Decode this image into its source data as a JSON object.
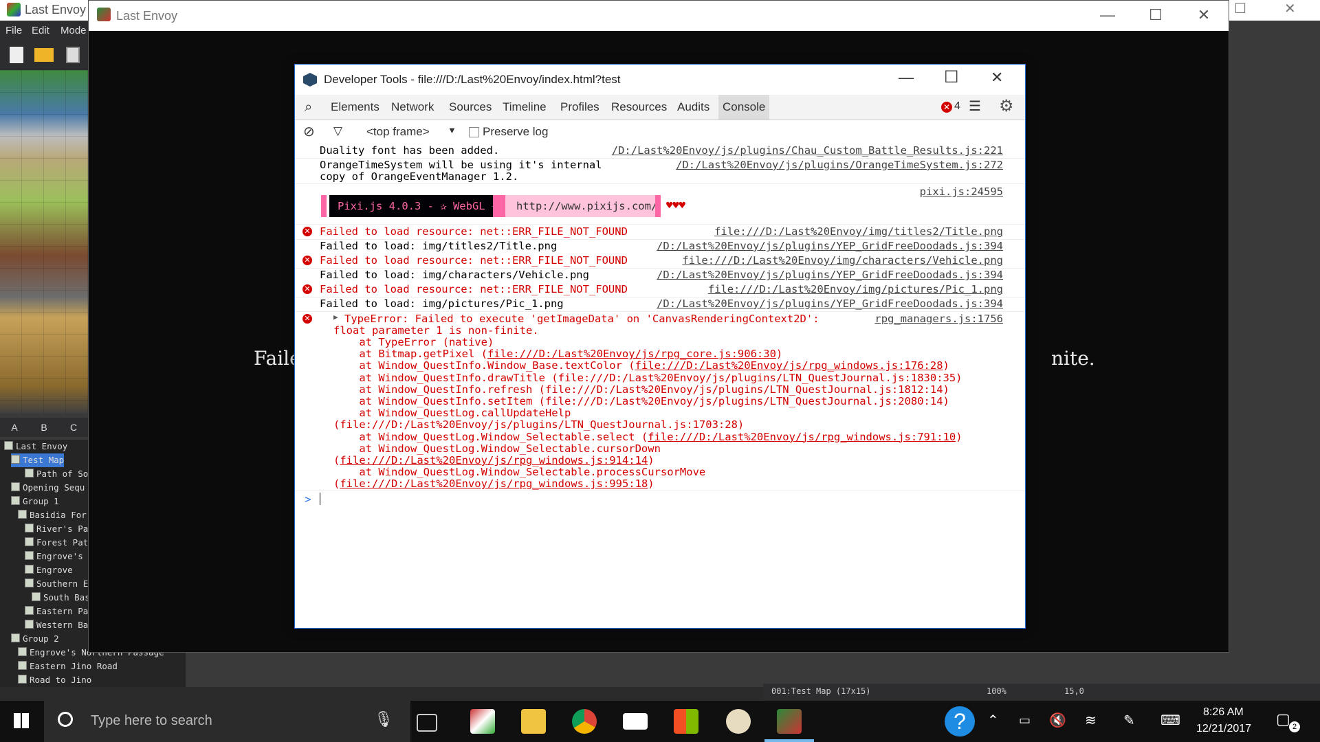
{
  "editor": {
    "title": "Last Envoy",
    "menu": [
      "File",
      "Edit",
      "Mode"
    ],
    "tabs": [
      "A",
      "B",
      "C"
    ],
    "tree": [
      {
        "label": "Last Envoy",
        "indent": 0
      },
      {
        "label": "Test Map",
        "indent": 1,
        "selected": true
      },
      {
        "label": "Path of Sou",
        "indent": 3
      },
      {
        "label": "Opening Sequ",
        "indent": 1
      },
      {
        "label": "Group 1",
        "indent": 1
      },
      {
        "label": "Basidia For",
        "indent": 2
      },
      {
        "label": "River's Pa",
        "indent": 3
      },
      {
        "label": "Forest Pat",
        "indent": 3
      },
      {
        "label": "Engrove's",
        "indent": 3
      },
      {
        "label": "Engrove",
        "indent": 3
      },
      {
        "label": "Southern E",
        "indent": 3
      },
      {
        "label": "South Bas",
        "indent": 4
      },
      {
        "label": "Eastern Pa",
        "indent": 3
      },
      {
        "label": "Western Ba",
        "indent": 3
      },
      {
        "label": "Group 2",
        "indent": 1
      },
      {
        "label": "Engrove's Northern Passage",
        "indent": 2
      },
      {
        "label": "Eastern Jino Road",
        "indent": 2
      },
      {
        "label": "Road to Jino",
        "indent": 2
      }
    ],
    "status_map": "001:Test Map (17x15)",
    "status_zoom": "100%",
    "status_coord": "15,0"
  },
  "game": {
    "title": "Last Envoy",
    "error_left": "Faile",
    "error_right": "nite."
  },
  "devtools": {
    "title": "Developer Tools - file:///D:/Last%20Envoy/index.html?test",
    "tabs": [
      "Elements",
      "Network",
      "Sources",
      "Timeline",
      "Profiles",
      "Resources",
      "Audits",
      "Console"
    ],
    "error_count": "4",
    "frame": "<top frame>",
    "preserve_log": "Preserve log",
    "pixi_banner": "Pixi.js 4.0.3 - ✰ WebGL ✰",
    "pixi_url": "http://www.pixijs.com/",
    "pixi_hearts": "♥♥♥",
    "pixi_src": "pixi.js:24595",
    "lines": [
      {
        "msg": "Duality font has been added.",
        "src": "/D:/Last%20Envoy/js/plugins/Chau_Custom_Battle_Results.js:221",
        "err": false
      },
      {
        "msg": "OrangeTimeSystem will be using it's internal",
        "msg2": "copy of OrangeEventManager 1.2.",
        "src": "/D:/Last%20Envoy/js/plugins/OrangeTimeSystem.js:272",
        "err": false
      },
      {
        "msg": "Failed to load resource: net::ERR_FILE_NOT_FOUND",
        "src": "file:///D:/Last%20Envoy/img/titles2/Title.png",
        "err": true
      },
      {
        "msg": "Failed to load: img/titles2/Title.png",
        "src": "/D:/Last%20Envoy/js/plugins/YEP_GridFreeDoodads.js:394",
        "err": false
      },
      {
        "msg": "Failed to load resource: net::ERR_FILE_NOT_FOUND",
        "src": "file:///D:/Last%20Envoy/img/characters/Vehicle.png",
        "err": true
      },
      {
        "msg": "Failed to load: img/characters/Vehicle.png",
        "src": "/D:/Last%20Envoy/js/plugins/YEP_GridFreeDoodads.js:394",
        "err": false
      },
      {
        "msg": "Failed to load resource: net::ERR_FILE_NOT_FOUND",
        "src": "file:///D:/Last%20Envoy/img/pictures/Pic_1.png",
        "err": true
      },
      {
        "msg": "Failed to load: img/pictures/Pic_1.png",
        "src": "/D:/Last%20Envoy/js/plugins/YEP_GridFreeDoodads.js:394",
        "err": false
      }
    ],
    "type_error": {
      "head": "TypeError: Failed to execute 'getImageData' on 'CanvasRenderingContext2D':",
      "head2": "float parameter 1 is non-finite.",
      "src": "rpg_managers.js:1756",
      "stack": [
        {
          "pre": "    at TypeError (native)",
          "link": "",
          "post": ""
        },
        {
          "pre": "    at Bitmap.getPixel (",
          "link": "file:///D:/Last%20Envoy/js/rpg_core.js:906:30",
          "post": ")"
        },
        {
          "pre": "    at Window_QuestInfo.Window_Base.textColor (",
          "link": "file:///D:/Last%20Envoy/js/rpg_windows.js:176:28",
          "post": ")"
        },
        {
          "pre": "    at Window_QuestInfo.drawTitle (file:///D:/Last%20Envoy/js/plugins/LTN_QuestJournal.js:1830:35)",
          "link": "",
          "post": ""
        },
        {
          "pre": "    at Window_QuestInfo.refresh (file:///D:/Last%20Envoy/js/plugins/LTN_QuestJournal.js:1812:14)",
          "link": "",
          "post": ""
        },
        {
          "pre": "    at Window_QuestInfo.setItem (file:///D:/Last%20Envoy/js/plugins/LTN_QuestJournal.js:2080:14)",
          "link": "",
          "post": ""
        },
        {
          "pre": "    at Window_QuestLog.callUpdateHelp",
          "link": "",
          "post": ""
        },
        {
          "pre": "(file:///D:/Last%20Envoy/js/plugins/LTN_QuestJournal.js:1703:28)",
          "link": "",
          "post": ""
        },
        {
          "pre": "    at Window_QuestLog.Window_Selectable.select (",
          "link": "file:///D:/Last%20Envoy/js/rpg_windows.js:791:10",
          "post": ")"
        },
        {
          "pre": "    at Window_QuestLog.Window_Selectable.cursorDown",
          "link": "",
          "post": ""
        },
        {
          "pre": "(",
          "link": "file:///D:/Last%20Envoy/js/rpg_windows.js:914:14",
          "post": ")"
        },
        {
          "pre": "    at Window_QuestLog.Window_Selectable.processCursorMove",
          "link": "",
          "post": ""
        },
        {
          "pre": "(",
          "link": "file:///D:/Last%20Envoy/js/rpg_windows.js:995:18",
          "post": ")"
        }
      ]
    },
    "prompt": ">"
  },
  "taskbar": {
    "search_placeholder": "Type here to search",
    "time": "8:26 AM",
    "date": "12/21/2017",
    "notif_count": "2"
  }
}
